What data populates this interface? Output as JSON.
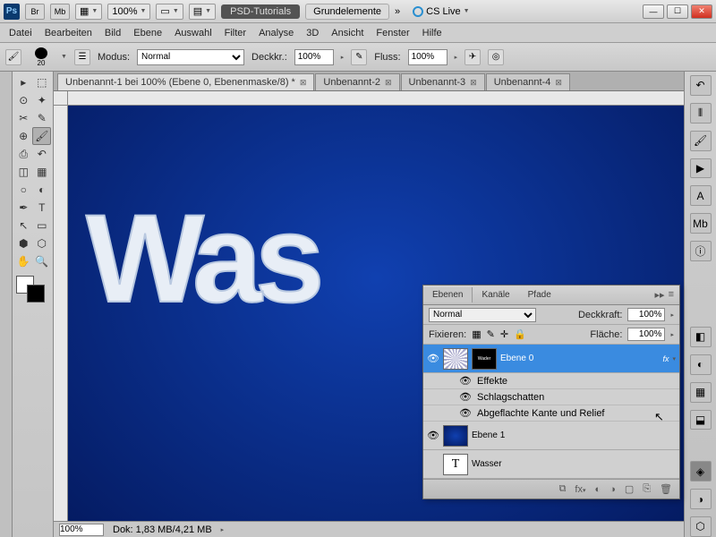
{
  "titlebar": {
    "app_abbr": "Ps",
    "btn_br": "Br",
    "btn_mb": "Mb",
    "zoom": "100%",
    "workspace_btn": "PSD-Tutorials",
    "workspace2": "Grundelemente",
    "cslive": "CS Live"
  },
  "menu": {
    "items": [
      "Datei",
      "Bearbeiten",
      "Bild",
      "Ebene",
      "Auswahl",
      "Filter",
      "Analyse",
      "3D",
      "Ansicht",
      "Fenster",
      "Hilfe"
    ]
  },
  "optbar": {
    "brush_size": "20",
    "modus_lbl": "Modus:",
    "modus_val": "Normal",
    "deckkr_lbl": "Deckkr.:",
    "deckkr_val": "100%",
    "fluss_lbl": "Fluss:",
    "fluss_val": "100%"
  },
  "doctabs": [
    {
      "label": "Unbenannt-1 bei 100% (Ebene 0, Ebenenmaske/8) *",
      "active": true
    },
    {
      "label": "Unbenannt-2",
      "active": false
    },
    {
      "label": "Unbenannt-3",
      "active": false
    },
    {
      "label": "Unbenannt-4",
      "active": false
    }
  ],
  "canvas_text": "Was",
  "layers_panel": {
    "tabs": [
      "Ebenen",
      "Kanäle",
      "Pfade"
    ],
    "blend_mode": "Normal",
    "deckkraft_lbl": "Deckkraft:",
    "deckkraft_val": "100%",
    "fixieren_lbl": "Fixieren:",
    "flaeche_lbl": "Fläche:",
    "flaeche_val": "100%",
    "layers": [
      {
        "name": "Ebene 0",
        "selected": true,
        "fx": "fx"
      },
      {
        "name": "Effekte",
        "kind": "effects-header"
      },
      {
        "name": "Schlagschatten",
        "kind": "effect"
      },
      {
        "name": "Abgeflachte Kante und Relief",
        "kind": "effect"
      },
      {
        "name": "Ebene 1"
      },
      {
        "name": "Wasser",
        "kind": "text"
      }
    ],
    "foot_icons": [
      "⟲",
      "fx",
      "◐",
      "▭",
      "▢",
      "⎘",
      "🗑"
    ]
  },
  "statusbar": {
    "zoom": "100%",
    "doc": "Dok: 1,83 MB/4,21 MB"
  }
}
